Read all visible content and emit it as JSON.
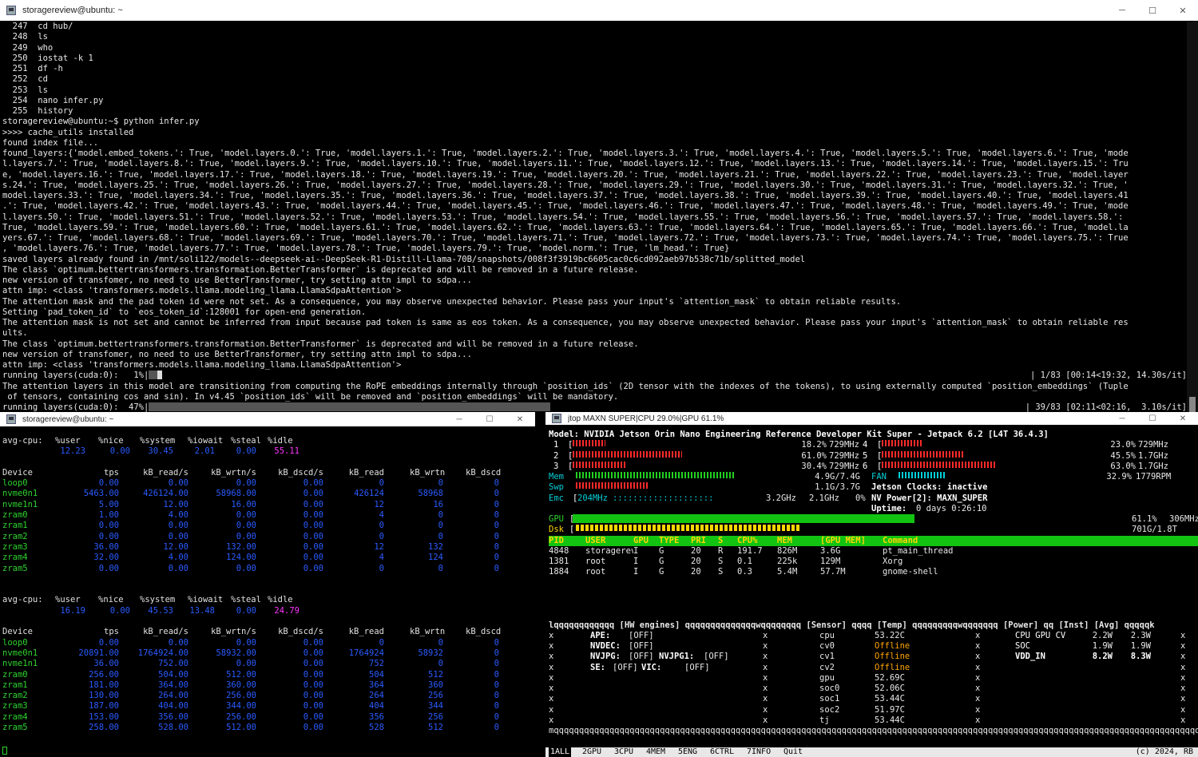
{
  "top_window": {
    "title": "storagereview@ubuntu: ~",
    "controls": [
      "─",
      "☐",
      "✕"
    ],
    "lines": [
      "  247  cd hub/",
      "  248  ls",
      "  249  who",
      "  250  iostat -k 1",
      "  251  df -h",
      "  252  cd",
      "  253  ls",
      "  254  nano infer.py",
      "  255  history",
      "storagereview@ubuntu:~$ python infer.py",
      ">>>> cache_utils installed",
      "found index file...",
      "found_layers:{'model.embed_tokens.': True, 'model.layers.0.': True, 'model.layers.1.': True, 'model.layers.2.': True, 'model.layers.3.': True, 'model.layers.4.': True, 'model.layers.5.': True, 'model.layers.6.': True, 'mode",
      "l.layers.7.': True, 'model.layers.8.': True, 'model.layers.9.': True, 'model.layers.10.': True, 'model.layers.11.': True, 'model.layers.12.': True, 'model.layers.13.': True, 'model.layers.14.': True, 'model.layers.15.': Tru",
      "e, 'model.layers.16.': True, 'model.layers.17.': True, 'model.layers.18.': True, 'model.layers.19.': True, 'model.layers.20.': True, 'model.layers.21.': True, 'model.layers.22.': True, 'model.layers.23.': True, 'model.layer",
      "s.24.': True, 'model.layers.25.': True, 'model.layers.26.': True, 'model.layers.27.': True, 'model.layers.28.': True, 'model.layers.29.': True, 'model.layers.30.': True, 'model.layers.31.': True, 'model.layers.32.': True, '",
      "model.layers.33.': True, 'model.layers.34.': True, 'model.layers.35.': True, 'model.layers.36.': True, 'model.layers.37.': True, 'model.layers.38.': True, 'model.layers.39.': True, 'model.layers.40.': True, 'model.layers.41",
      ".': True, 'model.layers.42.': True, 'model.layers.43.': True, 'model.layers.44.': True, 'model.layers.45.': True, 'model.layers.46.': True, 'model.layers.47.': True, 'model.layers.48.': True, 'model.layers.49.': True, 'mode",
      "l.layers.50.': True, 'model.layers.51.': True, 'model.layers.52.': True, 'model.layers.53.': True, 'model.layers.54.': True, 'model.layers.55.': True, 'model.layers.56.': True, 'model.layers.57.': True, 'model.layers.58.':",
      "True, 'model.layers.59.': True, 'model.layers.60.': True, 'model.layers.61.': True, 'model.layers.62.': True, 'model.layers.63.': True, 'model.layers.64.': True, 'model.layers.65.': True, 'model.layers.66.': True, 'model.la",
      "yers.67.': True, 'model.layers.68.': True, 'model.layers.69.': True, 'model.layers.70.': True, 'model.layers.71.': True, 'model.layers.72.': True, 'model.layers.73.': True, 'model.layers.74.': True, 'model.layers.75.': True",
      ", 'model.layers.76.': True, 'model.layers.77.': True, 'model.layers.78.': True, 'model.layers.79.': True, 'model.norm.': True, 'lm_head.': True}",
      "saved layers already found in /mnt/soli122/models--deepseek-ai--DeepSeek-R1-Distill-Llama-70B/snapshots/008f3f3919bc6605cac0c6cd092aeb97b538c71b/splitted_model",
      "The class `optimum.bettertransformers.transformation.BetterTransformer` is deprecated and will be removed in a future release.",
      "new version of transfomer, no need to use BetterTransformer, try setting attn impl to sdpa...",
      "attn imp: <class 'transformers.models.llama.modeling_llama.LlamaSdpaAttention'>",
      "The attention mask and the pad token id were not set. As a consequence, you may observe unexpected behavior. Please pass your input's `attention_mask` to obtain reliable results.",
      "Setting `pad_token_id` to `eos_token_id`:128001 for open-end generation.",
      "The attention mask is not set and cannot be inferred from input because pad token is same as eos token. As a consequence, you may observe unexpected behavior. Please pass your input's `attention_mask` to obtain reliable res",
      "ults.",
      "The class `optimum.bettertransformers.transformation.BetterTransformer` is deprecated and will be removed in a future release.",
      "new version of transfomer, no need to use BetterTransformer, try setting attn impl to sdpa...",
      "attn imp: <class 'transformers.models.llama.modeling_llama.LlamaSdpaAttention'>"
    ],
    "progress1_left": "running layers(cuda:0):   1%|",
    "progress1_right": "| 1/83 [00:14<19:32, 14.30s/it]",
    "progress1_fraction": 0.01,
    "warn_lines": [
      "The attention layers in this model are transitioning from computing the RoPE embeddings internally through `position_ids` (2D tensor with the indexes of the tokens), to using externally computed `position_embeddings` (Tuple",
      " of tensors, containing cos and sin). In v4.45 `position_ids` will be removed and `position_embeddings` will be mandatory."
    ],
    "progress2_left": "running layers(cuda:0):  47%|",
    "progress2_right": "| 39/83 [02:11<02:16,  3.10s/it]",
    "progress2_fraction": 0.47
  },
  "iostat_window": {
    "title": "storagereview@ubuntu: ~",
    "controls": [
      "─",
      "☐",
      "✕"
    ],
    "cpu_header": [
      "avg-cpu:",
      "%user",
      "%nice",
      "%system",
      "%iowait",
      "%steal",
      "%idle"
    ],
    "dev_header": [
      "Device",
      "tps",
      "kB_read/s",
      "kB_wrtn/s",
      "kB_dscd/s",
      "kB_read",
      "kB_wrtn",
      "kB_dscd"
    ],
    "blocks": [
      {
        "cpu": [
          "12.23",
          "0.00",
          "30.45",
          "2.01",
          "0.00",
          "55.11"
        ],
        "devices": [
          [
            "loop0",
            "0.00",
            "0.00",
            "0.00",
            "0.00",
            "0",
            "0",
            "0"
          ],
          [
            "nvme0n1",
            "5463.00",
            "426124.00",
            "58968.00",
            "0.00",
            "426124",
            "58968",
            "0"
          ],
          [
            "nvme1n1",
            "5.00",
            "12.00",
            "16.00",
            "0.00",
            "12",
            "16",
            "0"
          ],
          [
            "zram0",
            "1.00",
            "4.00",
            "0.00",
            "0.00",
            "4",
            "0",
            "0"
          ],
          [
            "zram1",
            "0.00",
            "0.00",
            "0.00",
            "0.00",
            "0",
            "0",
            "0"
          ],
          [
            "zram2",
            "0.00",
            "0.00",
            "0.00",
            "0.00",
            "0",
            "0",
            "0"
          ],
          [
            "zram3",
            "36.00",
            "12.00",
            "132.00",
            "0.00",
            "12",
            "132",
            "0"
          ],
          [
            "zram4",
            "32.00",
            "4.00",
            "124.00",
            "0.00",
            "4",
            "124",
            "0"
          ],
          [
            "zram5",
            "0.00",
            "0.00",
            "0.00",
            "0.00",
            "0",
            "0",
            "0"
          ]
        ]
      },
      {
        "cpu": [
          "16.19",
          "0.00",
          "45.53",
          "13.48",
          "0.00",
          "24.79"
        ],
        "devices": [
          [
            "loop0",
            "0.00",
            "0.00",
            "0.00",
            "0.00",
            "0",
            "0",
            "0"
          ],
          [
            "nvme0n1",
            "20891.00",
            "1764924.00",
            "58932.00",
            "0.00",
            "1764924",
            "58932",
            "0"
          ],
          [
            "nvme1n1",
            "36.00",
            "752.00",
            "0.00",
            "0.00",
            "752",
            "0",
            "0"
          ],
          [
            "zram0",
            "256.00",
            "504.00",
            "512.00",
            "0.00",
            "504",
            "512",
            "0"
          ],
          [
            "zram1",
            "181.00",
            "364.00",
            "360.00",
            "0.00",
            "364",
            "360",
            "0"
          ],
          [
            "zram2",
            "130.00",
            "264.00",
            "256.00",
            "0.00",
            "264",
            "256",
            "0"
          ],
          [
            "zram3",
            "187.00",
            "404.00",
            "344.00",
            "0.00",
            "404",
            "344",
            "0"
          ],
          [
            "zram4",
            "153.00",
            "356.00",
            "256.00",
            "0.00",
            "356",
            "256",
            "0"
          ],
          [
            "zram5",
            "258.00",
            "528.00",
            "512.00",
            "0.00",
            "528",
            "512",
            "0"
          ]
        ]
      }
    ]
  },
  "jtop_window": {
    "title": "jtop MAXN SUPER|CPU 29.0%|GPU 61.1%",
    "controls": [
      "─",
      "☐",
      "✕"
    ],
    "model_line": "Model: NVIDIA Jetson Orin Nano Engineering Reference Developer Kit Super - Jetpack 6.2 [L4T 36.4.3]",
    "cores": [
      {
        "id": "1",
        "pct": "18.2%",
        "freq": "729MHz",
        "val": 0.182
      },
      {
        "id": "2",
        "pct": "61.0%",
        "freq": "729MHz",
        "val": 0.61
      },
      {
        "id": "3",
        "pct": "30.4%",
        "freq": "729MHz",
        "val": 0.304
      },
      {
        "id": "4",
        "pct": "23.0%",
        "freq": "729MHz",
        "val": 0.23
      },
      {
        "id": "5",
        "pct": "45.5%",
        "freq": "1.7GHz",
        "val": 0.455
      },
      {
        "id": "6",
        "pct": "63.0%",
        "freq": "1.7GHz",
        "val": 0.63
      }
    ],
    "mem": {
      "label": "Mem",
      "value": "4.9G/7.4G",
      "fraction": 0.66
    },
    "fan": {
      "label": "FAN",
      "pct": "32.9%",
      "rpm": "1779RPM",
      "fraction": 0.329
    },
    "swp": {
      "label": "Swp",
      "value": "1.1G/3.7G",
      "fraction": 0.3
    },
    "clocks": "Jetson Clocks: inactive",
    "emc": {
      "label": "Emc",
      "freq": "204MHz",
      "max": "3.2GHz",
      "cur": "2.1GHz",
      "pct": "0%"
    },
    "nvpower": "NV Power[2]: MAXN_SUPER",
    "uptime_label": "Uptime:",
    "uptime": "0 days 0:26:10",
    "gpu": {
      "label": "GPU",
      "pct": "61.1%",
      "freq": "306MHz",
      "fraction": 0.611
    },
    "dsk": {
      "label": "Dsk",
      "value": "701G/1.8T",
      "fraction": 0.39
    },
    "proc_header": [
      "PID",
      "USER",
      "GPU",
      "TYPE",
      "PRI",
      "S",
      "CPU%",
      "MEM",
      "[GPU MEM]",
      "Command"
    ],
    "procs": [
      [
        "4848",
        "storagereview",
        "I",
        "G",
        "20",
        "R",
        "191.7",
        "826M",
        "3.6G",
        "pt_main_thread"
      ],
      [
        "1381",
        "root",
        "I",
        "G",
        "20",
        "S",
        "0.1",
        "225k",
        "129M",
        "Xorg"
      ],
      [
        "1884",
        "root",
        "I",
        "G",
        "20",
        "S",
        "0.3",
        "5.4M",
        "57.7M",
        "gnome-shell"
      ]
    ],
    "hw_title": "[HW engines]",
    "sensor_title": "[Sensor]",
    "temp_title": "[Temp]",
    "power_title": "[Power]",
    "inst_title": "[Inst]",
    "avg_title": "[Avg]",
    "engines": [
      [
        "APE:",
        "[OFF]",
        "",
        ""
      ],
      [
        "NVDEC:",
        "[OFF]",
        "",
        ""
      ],
      [
        "NVJPG:",
        "[OFF]",
        "NVJPG1:",
        "[OFF]"
      ],
      [
        "SE:",
        "[OFF]",
        "VIC:",
        "[OFF]"
      ]
    ],
    "sensors": [
      [
        "cpu",
        "53.22C"
      ],
      [
        "cv0",
        "Offline"
      ],
      [
        "cv1",
        "Offline"
      ],
      [
        "cv2",
        "Offline"
      ],
      [
        "gpu",
        "52.69C"
      ],
      [
        "soc0",
        "52.06C"
      ],
      [
        "soc1",
        "53.44C"
      ],
      [
        "soc2",
        "51.97C"
      ],
      [
        "tj",
        "53.44C"
      ]
    ],
    "power": [
      [
        "CPU GPU CV",
        "2.2W",
        "2.3W"
      ],
      [
        "SOC",
        "1.9W",
        "1.9W"
      ],
      [
        "VDD_IN",
        "8.2W",
        "8.3W"
      ]
    ],
    "menu": [
      "1ALL",
      "2GPU",
      "3CPU",
      "4MEM",
      "5ENG",
      "6CTRL",
      "7INFO",
      "Quit"
    ],
    "copyright": "(c) 2024, RB",
    "frame_top": "lqqqqqqqqqqqq [HW engines] qqqqqqqqqqqqqqwqqqqqqqq [Sensor] qqqq [Temp] qqqqqqqqqwqqqqqqq [Power] qq [Inst]  [Avg]  qqqqqk",
    "frame_bot": "mqqqqqqqqqqqqqqqqqqqqqqqqqqqqqqqqqqqqqqqqqqqqqqqqqqqqqqqqqqqqqqqqqqqqqqqqqqqqqqqqqqqqqqqqqqqqqqqqqqqqqqqqqqqqqqqqqqqqqqqqqqqqqqqqqj"
  }
}
